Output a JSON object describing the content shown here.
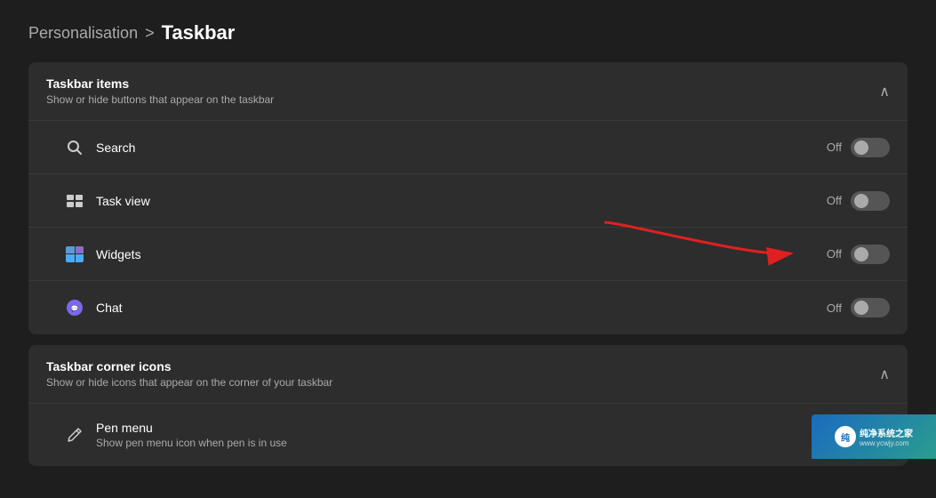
{
  "breadcrumb": {
    "parent": "Personalisation",
    "separator": ">",
    "current": "Taskbar"
  },
  "taskbar_items_section": {
    "title": "Taskbar items",
    "subtitle": "Show or hide buttons that appear on the taskbar",
    "chevron": "∧",
    "items": [
      {
        "id": "search",
        "label": "Search",
        "status": "Off",
        "icon_type": "search"
      },
      {
        "id": "task-view",
        "label": "Task view",
        "status": "Off",
        "icon_type": "taskview"
      },
      {
        "id": "widgets",
        "label": "Widgets",
        "status": "Off",
        "icon_type": "widgets"
      },
      {
        "id": "chat",
        "label": "Chat",
        "status": "Off",
        "icon_type": "chat"
      }
    ]
  },
  "taskbar_corner_section": {
    "title": "Taskbar corner icons",
    "subtitle": "Show or hide icons that appear on the corner of your taskbar",
    "chevron": "∧",
    "items": [
      {
        "id": "pen-menu",
        "label": "Pen menu",
        "sublabel": "Show pen menu icon when pen is in use",
        "icon_type": "pen"
      }
    ]
  },
  "watermark": {
    "line1": "纯净系统之家",
    "line2": "www.ycwjy.com"
  }
}
